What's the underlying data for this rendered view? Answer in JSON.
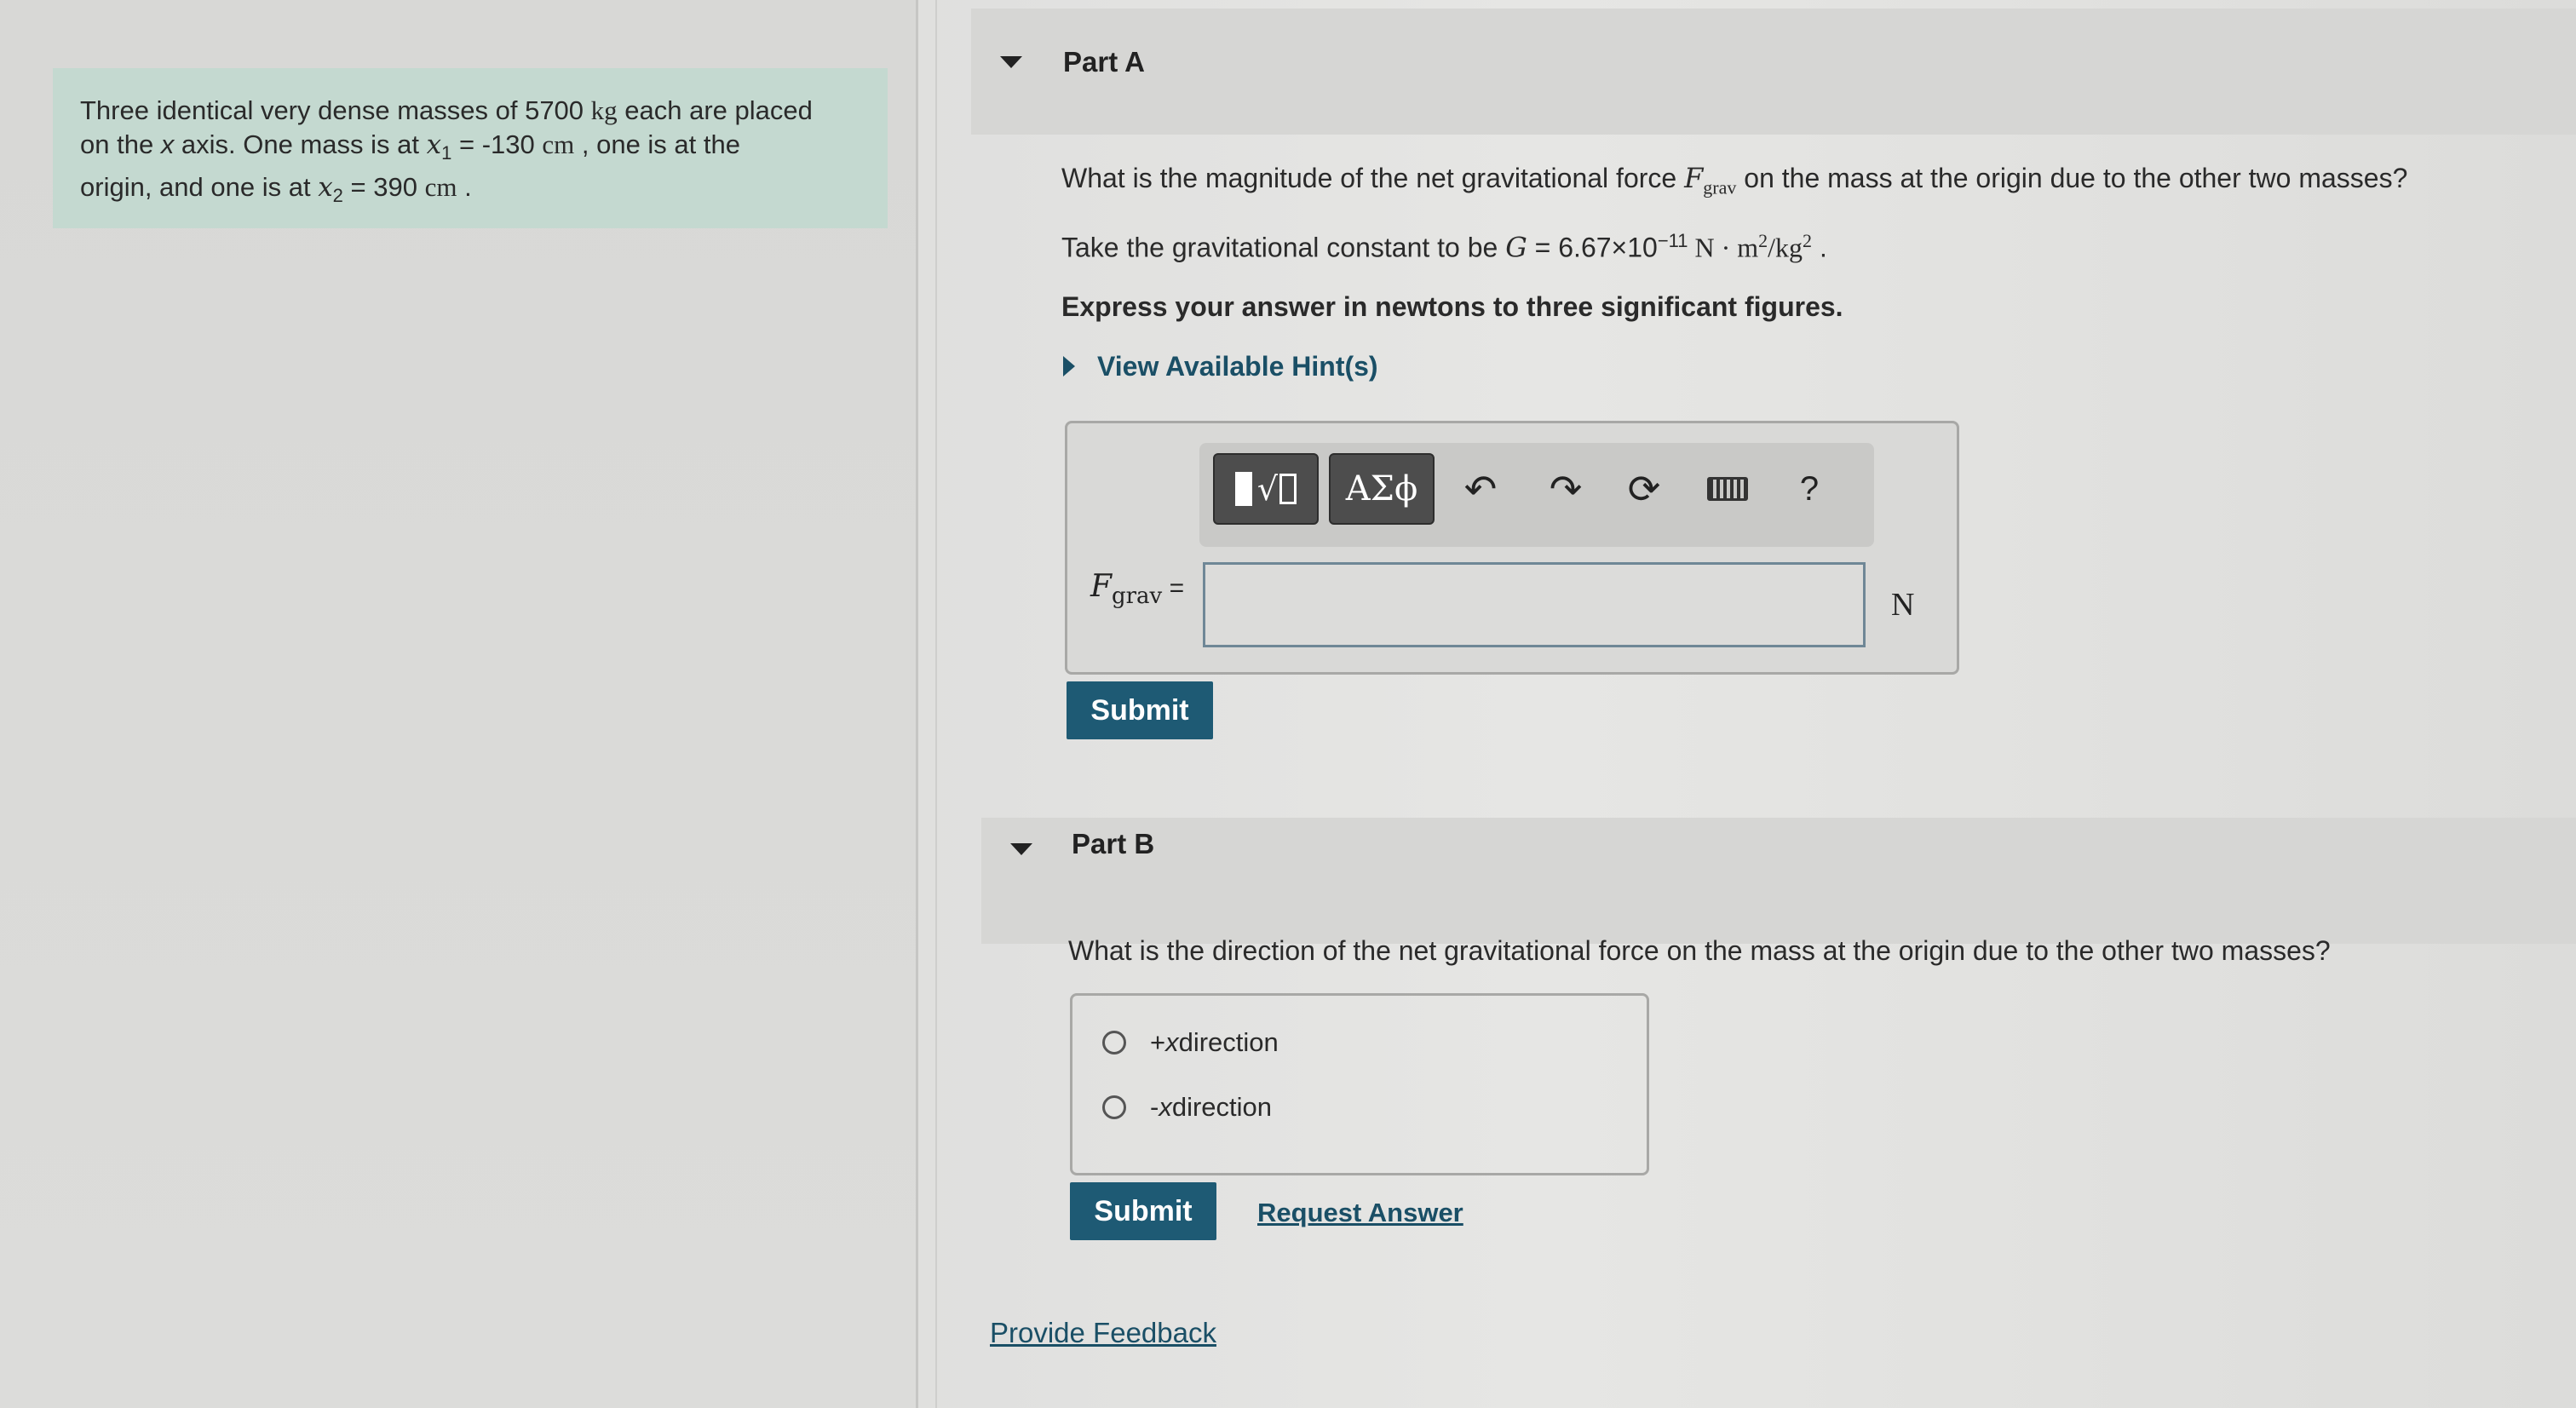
{
  "intro": {
    "line1_a": "Three identical very dense masses of 5700 ",
    "line1_unit": "kg",
    "line1_b": " each are placed",
    "line2_a": "on the ",
    "line2_x": "x",
    "line2_b": " axis. One mass is at ",
    "line2_var": "x",
    "line2_sub": "1",
    "line2_c": " = -130 ",
    "line2_unit": "cm",
    "line2_d": " , one is at the",
    "line3_a": "origin, and one is at ",
    "line3_var": "x",
    "line3_sub": "2",
    "line3_b": " = 390 ",
    "line3_unit": "cm",
    "line3_c": " ."
  },
  "part_a": {
    "title": "Part A",
    "question_a": "What is the magnitude of the net gravitational force ",
    "question_var": "F",
    "question_sub": "grav",
    "question_b": " on the mass at the origin due to the other two masses?",
    "constant_a": "Take the gravitational constant to be ",
    "constant_var": "G",
    "constant_b": " = 6.67×10",
    "constant_exp": "−11",
    "constant_unit_a": " N · m",
    "constant_unit_exp1": "2",
    "constant_unit_b": "/kg",
    "constant_unit_exp2": "2",
    "constant_c": " .",
    "instruction": "Express your answer in newtons to three significant figures.",
    "hint_label": "View Available Hint(s)",
    "answer_label_var": "F",
    "answer_label_sub": "grav",
    "answer_label_eq": " =",
    "answer_value": "",
    "unit": "N",
    "submit_label": "Submit",
    "toolbar": {
      "templates_icon": "templates-icon",
      "symbols_label": "ΑΣϕ",
      "undo_icon": "undo-icon",
      "redo_icon": "redo-icon",
      "reset_icon": "reset-icon",
      "keyboard_icon": "keyboard-icon",
      "help_label": "?"
    }
  },
  "part_b": {
    "title": "Part B",
    "question": "What is the direction of the net gravitational force on the mass at the origin due to the other two masses?",
    "options": [
      {
        "prefix": "+",
        "var": "x",
        "suffix": " direction"
      },
      {
        "prefix": "-",
        "var": "x",
        "suffix": " direction"
      }
    ],
    "submit_label": "Submit",
    "request_answer_label": "Request Answer"
  },
  "feedback_label": "Provide Feedback",
  "colors": {
    "intro_bg": "#c4d9d0",
    "submit_bg": "#1e5a74",
    "link": "#1a4f66"
  }
}
